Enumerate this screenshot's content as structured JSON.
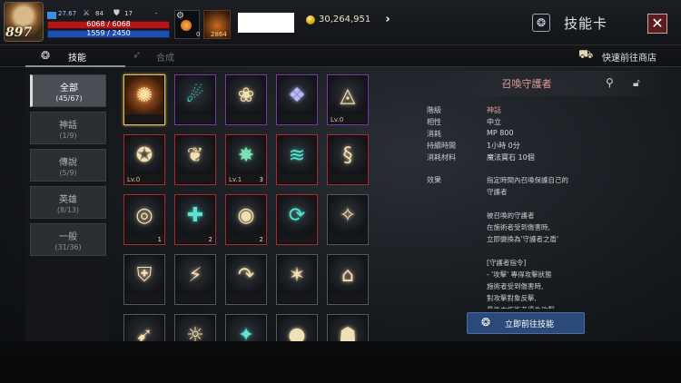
{
  "player": {
    "level": "897",
    "stat_main": "27.67",
    "stat_attack": "84",
    "stat_defense": "17",
    "stat_extra": "-",
    "hp": "6068 / 6068",
    "mp": "1559 / 2450",
    "potion_count": "0",
    "item_count": "2864"
  },
  "currency": {
    "gold": "30,264,951",
    "arrow": "›"
  },
  "header": {
    "title": "技能卡",
    "close": "✕",
    "title_icon": "❂"
  },
  "tabs": [
    {
      "label": "技能",
      "icon": "skill-icon"
    },
    {
      "label": "合成",
      "icon": "synth-icon"
    }
  ],
  "shop": {
    "label": "快速前往商店",
    "icon": "shop-icon"
  },
  "categories": [
    {
      "name": "全部",
      "count": "(45/67)",
      "active": true
    },
    {
      "name": "神話",
      "count": "(1/9)"
    },
    {
      "name": "傳說",
      "count": "(5/9)"
    },
    {
      "name": "英雄",
      "count": "(8/13)"
    },
    {
      "name": "一般",
      "count": "(31/36)"
    }
  ],
  "cards": [
    {
      "glyph": "✺",
      "rarity": "sel",
      "style": "fire",
      "lv": "",
      "cnt": ""
    },
    {
      "glyph": "☄",
      "rarity": "legend",
      "style": "teal",
      "lv": "",
      "cnt": ""
    },
    {
      "glyph": "❀",
      "rarity": "legend",
      "style": "",
      "lv": "",
      "cnt": ""
    },
    {
      "glyph": "❖",
      "rarity": "legend",
      "style": "prism",
      "lv": "",
      "cnt": ""
    },
    {
      "glyph": "◬",
      "rarity": "legend",
      "style": "",
      "lv": "Lv.0",
      "cnt": ""
    },
    {
      "glyph": "✪",
      "rarity": "myth",
      "style": "",
      "lv": "Lv.0",
      "cnt": ""
    },
    {
      "glyph": "❦",
      "rarity": "myth",
      "style": "",
      "lv": "",
      "cnt": ""
    },
    {
      "glyph": "✸",
      "rarity": "myth",
      "style": "green",
      "lv": "Lv.1",
      "cnt": "3"
    },
    {
      "glyph": "≋",
      "rarity": "myth",
      "style": "teal",
      "lv": "",
      "cnt": ""
    },
    {
      "glyph": "§",
      "rarity": "myth",
      "style": "",
      "lv": "",
      "cnt": ""
    },
    {
      "glyph": "◎",
      "rarity": "myth",
      "style": "",
      "lv": "",
      "cnt": "1"
    },
    {
      "glyph": "✚",
      "rarity": "myth",
      "style": "teal",
      "lv": "",
      "cnt": "2"
    },
    {
      "glyph": "◉",
      "rarity": "myth",
      "style": "",
      "lv": "",
      "cnt": "2"
    },
    {
      "glyph": "⟳",
      "rarity": "myth",
      "style": "teal",
      "lv": "",
      "cnt": ""
    },
    {
      "glyph": "✧",
      "rarity": "norm",
      "style": "",
      "lv": "",
      "cnt": ""
    },
    {
      "glyph": "⛨",
      "rarity": "norm",
      "style": "",
      "lv": "",
      "cnt": ""
    },
    {
      "glyph": "⚡",
      "rarity": "norm",
      "style": "",
      "lv": "",
      "cnt": ""
    },
    {
      "glyph": "↷",
      "rarity": "norm",
      "style": "",
      "lv": "",
      "cnt": ""
    },
    {
      "glyph": "✶",
      "rarity": "norm",
      "style": "",
      "lv": "",
      "cnt": ""
    },
    {
      "glyph": "⌂",
      "rarity": "norm",
      "style": "",
      "lv": "",
      "cnt": ""
    },
    {
      "glyph": "➹",
      "rarity": "norm",
      "style": "",
      "lv": "",
      "cnt": ""
    },
    {
      "glyph": "☼",
      "rarity": "norm",
      "style": "",
      "lv": "",
      "cnt": ""
    },
    {
      "glyph": "✦",
      "rarity": "norm",
      "style": "teal",
      "lv": "",
      "cnt": ""
    },
    {
      "glyph": "●",
      "rarity": "norm",
      "style": "",
      "lv": "",
      "cnt": ""
    },
    {
      "glyph": "☗",
      "rarity": "norm",
      "style": "",
      "lv": "",
      "cnt": ""
    }
  ],
  "detail": {
    "name": "召喚守護者",
    "rows": [
      {
        "label": "階級",
        "value": "神話"
      },
      {
        "label": "相性",
        "value": "中立"
      },
      {
        "label": "消耗",
        "value": "MP 800"
      },
      {
        "label": "持續時間",
        "value": "1小時 0分"
      },
      {
        "label": "消耗材料",
        "value": "魔法寶石 10個"
      }
    ],
    "effect_label": "效果",
    "effect_text": "指定時間內召喚保護自己的\n守護者\n\n被召喚的守護者\n在施術者受到傷害時,\n立即變換為'守護者之盾'\n\n[守護者指令]\n- '攻擊' 專得攻擊狀態\n施術者受到傷害時,\n對攻擊對象反擊,\n最後由施術者優先攻擊",
    "goto_label": "立即前往技能",
    "goto_icon": "❂"
  },
  "colors": {
    "myth": "#b22a2a",
    "legend": "#7a3aa8",
    "selected": "#e8c24a",
    "hp": "#b31616",
    "mp": "#1f4fb0",
    "button": "#2b4a7a"
  }
}
